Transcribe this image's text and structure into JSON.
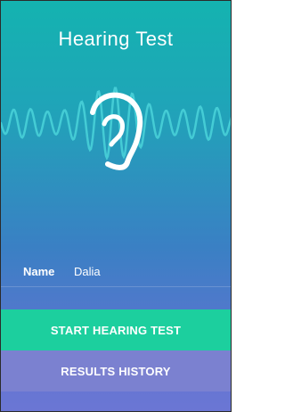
{
  "header": {
    "title": "Hearing Test"
  },
  "form": {
    "name_label": "Name",
    "name_value": "Dalia"
  },
  "actions": {
    "start_label": "START HEARING TEST",
    "history_label": "RESULTS HISTORY"
  },
  "colors": {
    "gradient_top": "#14b3b0",
    "gradient_bottom": "#6b76d4",
    "start_button": "#1ccf9e",
    "history_button": "#7b81d0",
    "wave": "#48d0d8"
  },
  "icons": {
    "ear": "ear-icon",
    "wave": "sound-wave-graphic"
  }
}
